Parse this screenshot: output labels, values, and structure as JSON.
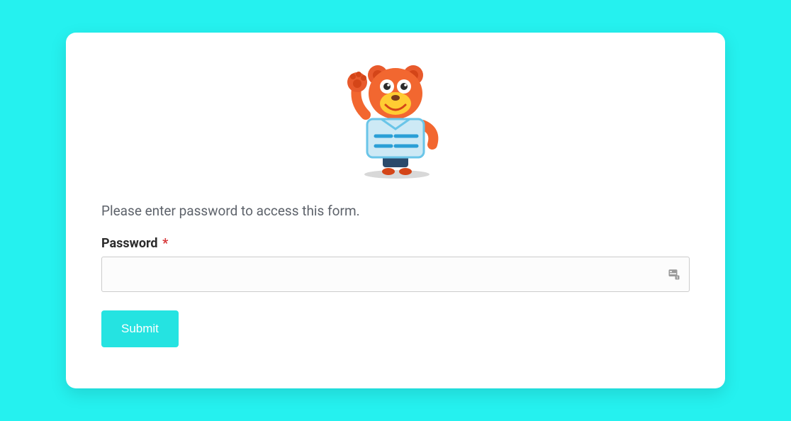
{
  "form": {
    "prompt": "Please enter password to access this form.",
    "password_label": "Password",
    "required_mark": "*",
    "password_value": "",
    "submit_label": "Submit"
  },
  "icons": {
    "mascot": "bear-mascot-icon",
    "password_manager": "password-manager-icon"
  },
  "colors": {
    "background": "#25f1ef",
    "card": "#ffffff",
    "button": "#25e3e1",
    "text_muted": "#5e636b",
    "required": "#d63638"
  }
}
